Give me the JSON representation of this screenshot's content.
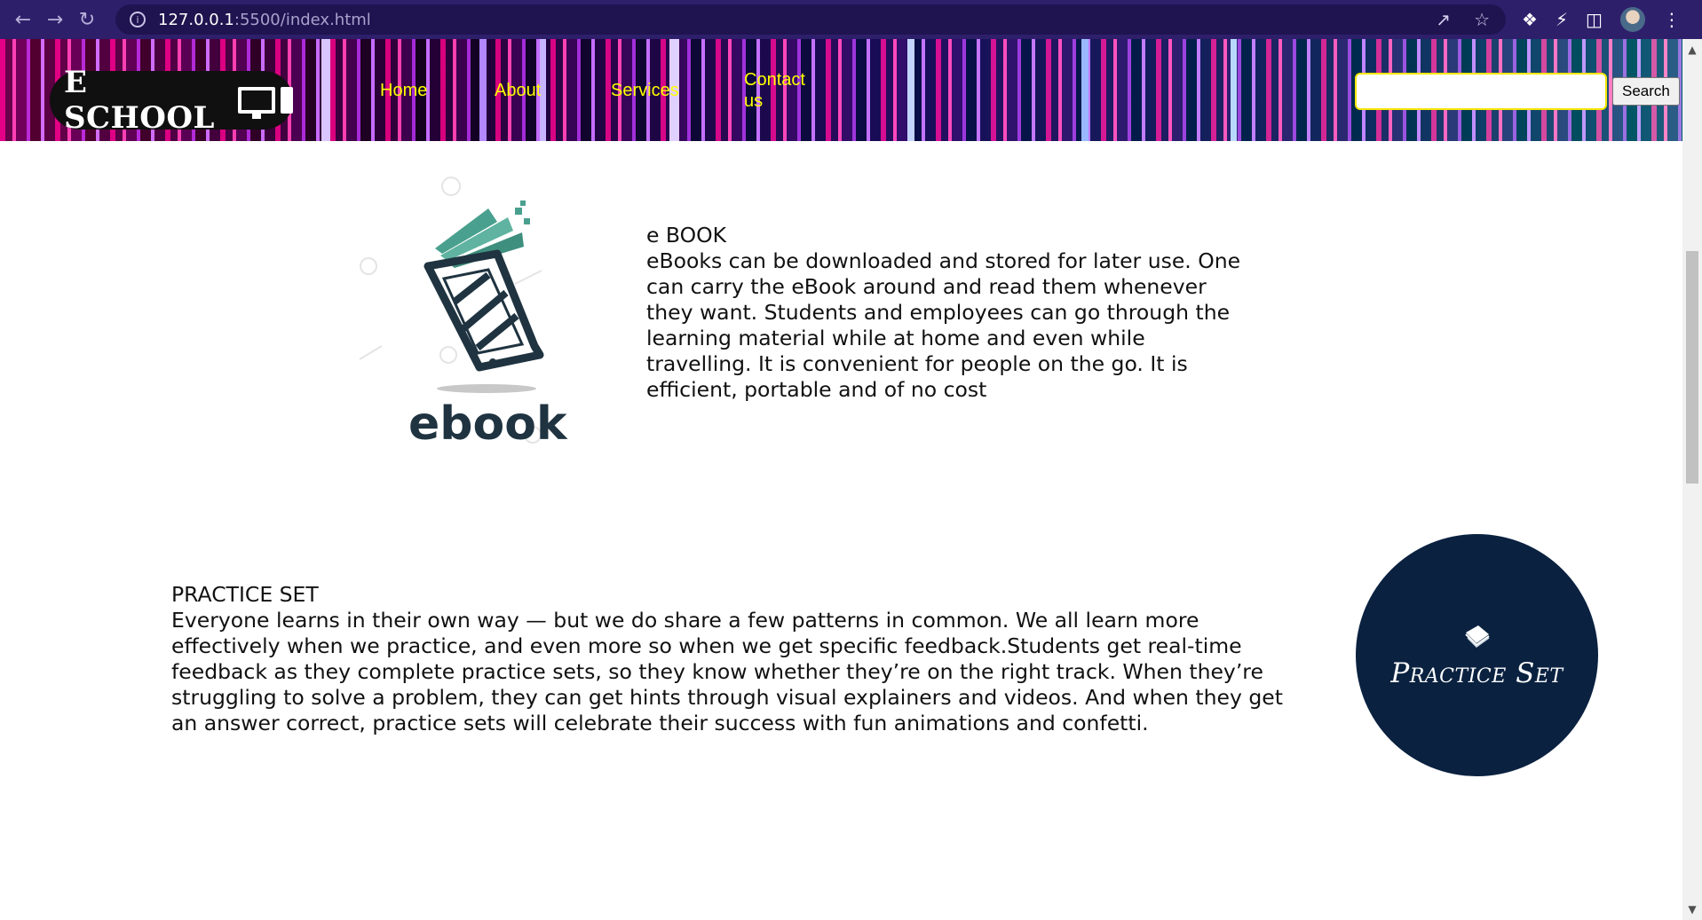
{
  "browser": {
    "url_host": "127.0.0.1",
    "url_path": ":5500/index.html"
  },
  "header": {
    "logo_text": "E SCHOOL",
    "nav": {
      "home": "Home",
      "about": "About",
      "services": "Services",
      "contact": "Contact us"
    },
    "search": {
      "value": "",
      "button_label": "Search"
    }
  },
  "ebook_section": {
    "image_label": "ebook",
    "title": "e BOOK",
    "body": "eBooks can be downloaded and stored for later use. One can carry the eBook around and read them whenever they want. Students and employees can go through the learning material while at home and even while travelling. It is convenient for people on the go. It is efficient, portable and of no cost"
  },
  "practice_section": {
    "title": "PRACTICE SET",
    "body": "Everyone learns in their own way — but we do share a few patterns in common. We all learn more effectively when we practice, and even more so when we get specific feedback.Students get real-time feedback as they complete practice sets, so they know whether they’re on the right track. When they’re struggling to solve a problem, they can get hints through visual explainers and videos. And when they get an answer correct, practice sets will celebrate their success with fun animations and confetti.",
    "badge_label": "Practice Set"
  },
  "colors": {
    "chrome_bg": "#2e1f6b",
    "nav_link": "#ffff00",
    "badge_bg": "#0a2140",
    "ebook_dark": "#1f3340",
    "ebook_teal": "#4aa08e"
  }
}
